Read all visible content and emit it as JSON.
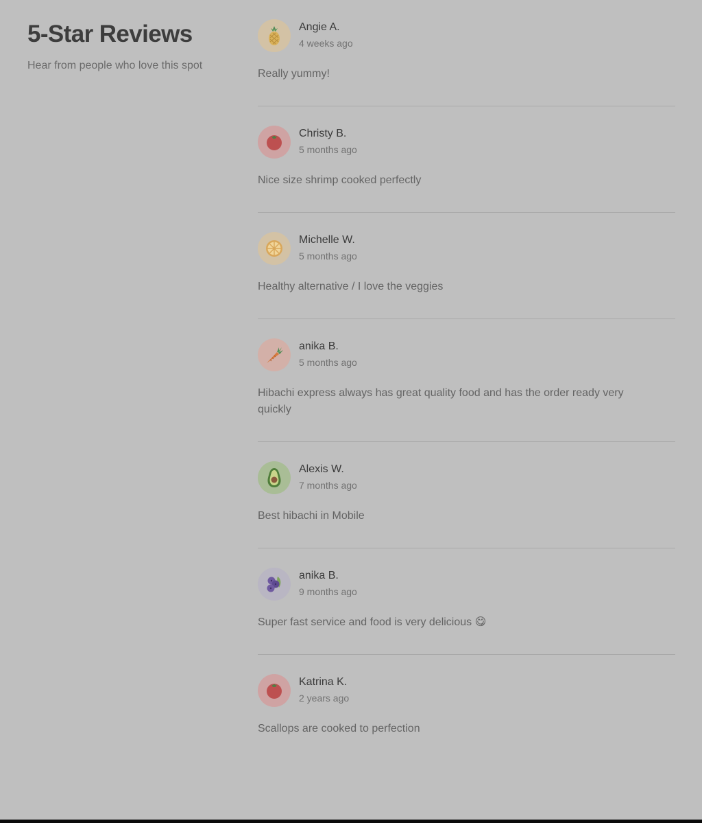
{
  "header": {
    "title": "5-Star Reviews",
    "subtitle": "Hear from people who love this spot"
  },
  "reviews": [
    {
      "name": "Angie A.",
      "date": "4 weeks ago",
      "text": "Really yummy!",
      "avatar_icon": "pineapple-icon",
      "avatar_bg": "#d3c2a5"
    },
    {
      "name": "Christy B.",
      "date": "5 months ago",
      "text": "Nice size shrimp cooked perfectly",
      "avatar_icon": "tomato-icon",
      "avatar_bg": "#cfa3a3"
    },
    {
      "name": "Michelle W.",
      "date": "5 months ago",
      "text": "Healthy alternative / I love the veggies",
      "avatar_icon": "orange-slice-icon",
      "avatar_bg": "#d3c2a5"
    },
    {
      "name": "anika B.",
      "date": "5 months ago",
      "text": "Hibachi express always has great quality food and has the order ready very quickly",
      "avatar_icon": "carrot-icon",
      "avatar_bg": "#d3b0a8"
    },
    {
      "name": "Alexis W.",
      "date": "7 months ago",
      "text": "Best hibachi in Mobile",
      "avatar_icon": "avocado-icon",
      "avatar_bg": "#a9bd96"
    },
    {
      "name": "anika B.",
      "date": "9 months ago",
      "text": "Super fast service and food is very delicious 😋",
      "avatar_icon": "blueberries-icon",
      "avatar_bg": "#b9b6c3"
    },
    {
      "name": "Katrina K.",
      "date": "2 years ago",
      "text": "Scallops are cooked to perfection",
      "avatar_icon": "tomato-icon",
      "avatar_bg": "#cfa3a3"
    }
  ]
}
